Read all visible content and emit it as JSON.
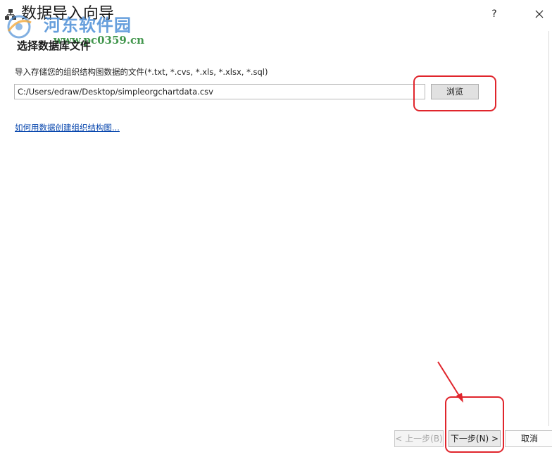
{
  "window": {
    "title": "数据导入向导",
    "help_label": "?",
    "icons": {
      "app": "org-chart-icon",
      "close": "close-icon"
    }
  },
  "watermark": {
    "name": "河东软件园",
    "url": "www.pc0359.cn"
  },
  "step": {
    "title": "选择数据库文件",
    "instruction": "导入存储您的组织结构图数据的文件(*.txt, *.cvs, *.xls, *.xlsx, *.sql)",
    "file_path": "C:/Users/edraw/Desktop/simpleorgchartdata.csv",
    "browse_label": "浏览",
    "help_link": "如何用数据创建组织结构图..."
  },
  "buttons": {
    "back_label": "< 上一步(B)",
    "next_label": "下一步(N) >",
    "cancel_label": "取消"
  },
  "annotations": {
    "highlight_color": "#e0252c"
  }
}
